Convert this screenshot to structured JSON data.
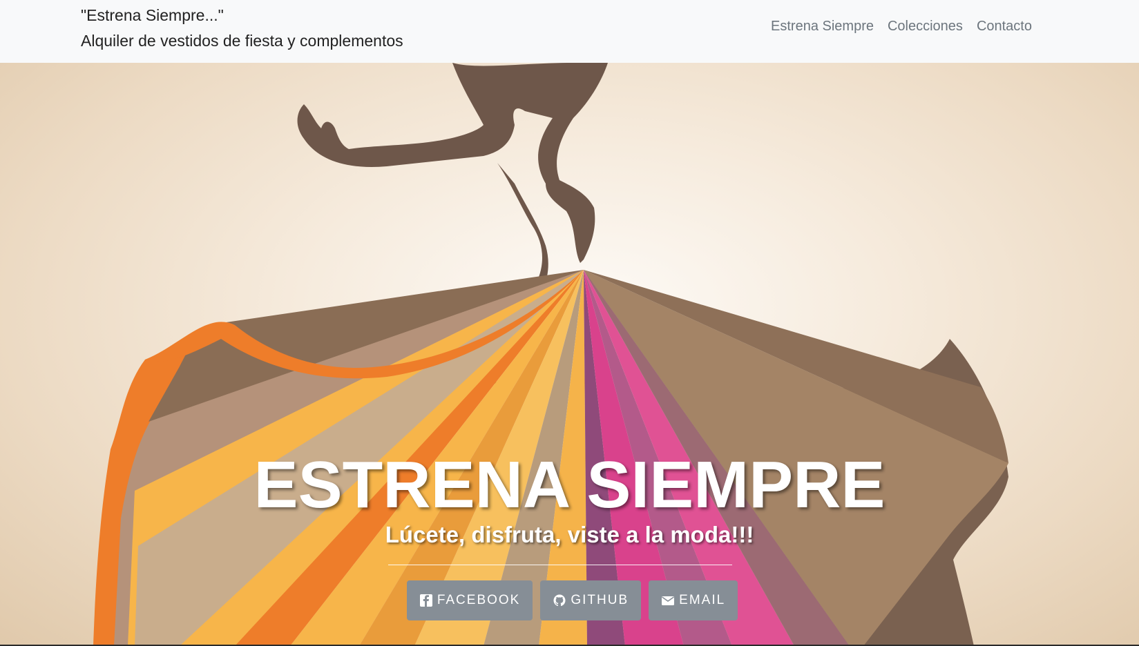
{
  "navbar": {
    "brand_line1": "\"Estrena Siempre...\"",
    "brand_line2": "Alquiler de vestidos de fiesta y complementos",
    "links": [
      {
        "label": "Estrena Siempre"
      },
      {
        "label": "Colecciones"
      },
      {
        "label": "Contacto"
      }
    ]
  },
  "hero": {
    "title": "ESTRENA SIEMPRE",
    "subtitle": "Lúcete, disfruta, viste a la moda!!!",
    "buttons": [
      {
        "label": "FACEBOOK",
        "icon": "facebook-icon"
      },
      {
        "label": "GITHUB",
        "icon": "github-icon"
      },
      {
        "label": "EMAIL",
        "icon": "envelope-icon"
      }
    ]
  },
  "colors": {
    "navbar_bg": "#f8f9fa",
    "nav_link": "#6c757d",
    "button_bg": "#868e96",
    "silhouette": "#6e574a",
    "orange": "#ee7d2a",
    "yellow": "#f7b54a",
    "magenta": "#d9428c",
    "purple": "#8f4a7a",
    "tan": "#b89c7c"
  }
}
